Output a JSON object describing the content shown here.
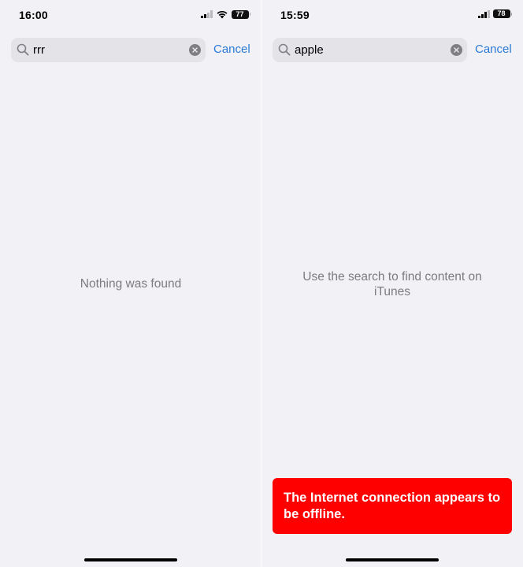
{
  "screens": [
    {
      "status_bar": {
        "time": "16:00",
        "battery": "77"
      },
      "search": {
        "query": "rrr",
        "cancel_label": "Cancel"
      },
      "message": "Nothing was found"
    },
    {
      "status_bar": {
        "time": "15:59",
        "battery": "78"
      },
      "search": {
        "query": "apple",
        "cancel_label": "Cancel"
      },
      "message": "Use the search to find content on iTunes",
      "toast": "The Internet connection appears to be offline."
    }
  ],
  "colors": {
    "background": "#f2f2f6",
    "search_field": "#e3e3e8",
    "cancel": "#2a7ad6",
    "message": "#7b7b80",
    "toast": "#fe0000"
  },
  "icons": [
    "search-icon",
    "clear-icon",
    "signal-icon",
    "wifi-icon",
    "battery-icon"
  ]
}
